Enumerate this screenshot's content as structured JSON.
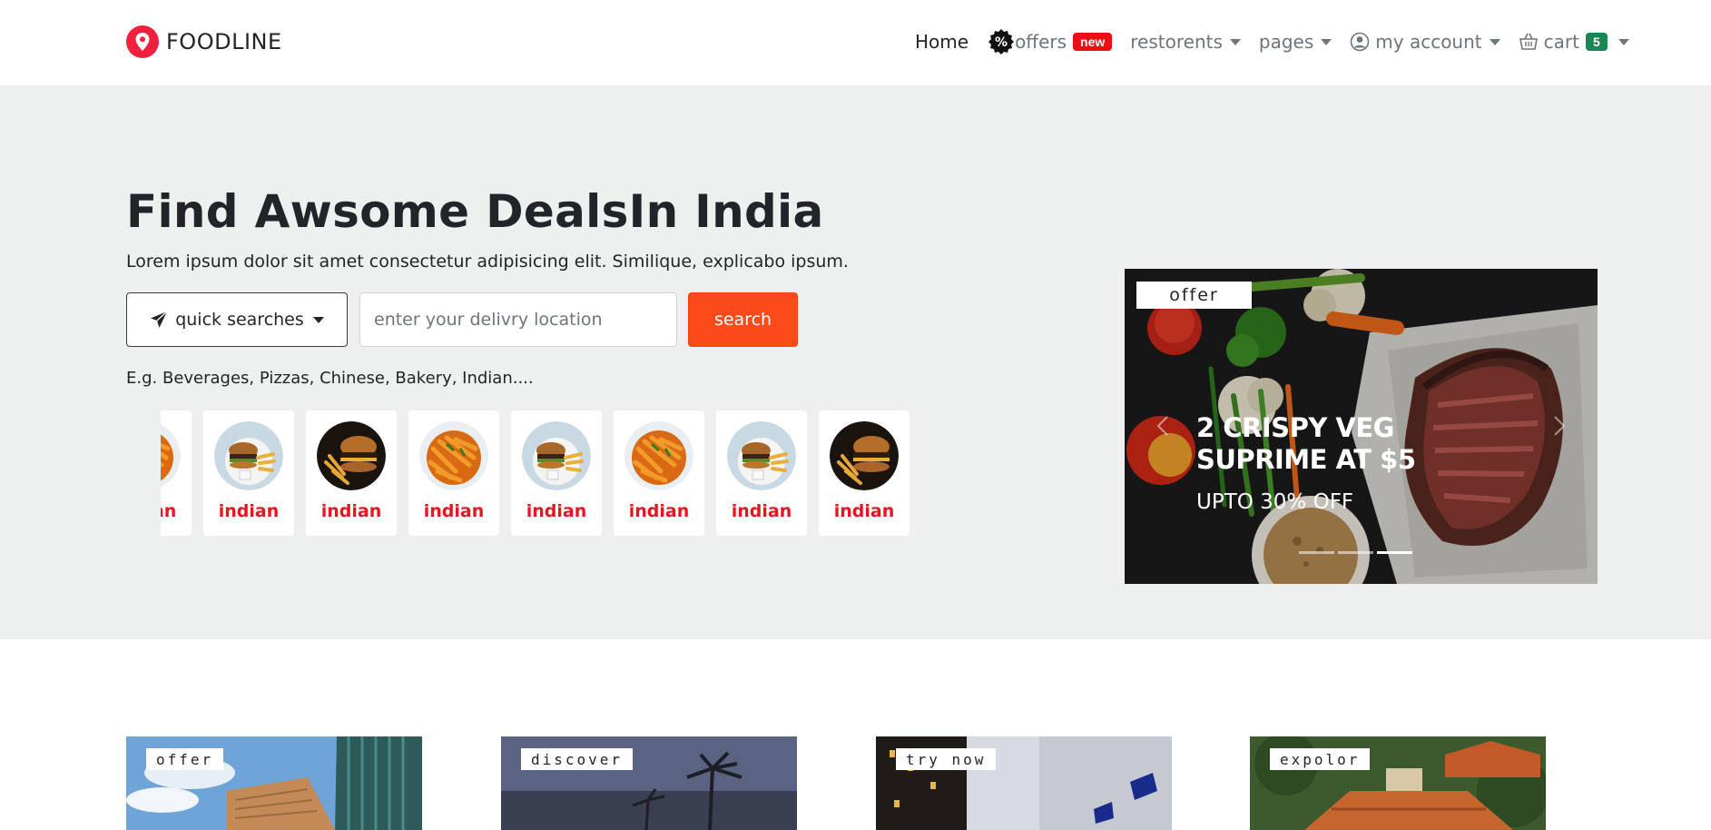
{
  "brand": {
    "name": "FOODLINE",
    "icon": "map-pin-icon",
    "color": "#f0213e"
  },
  "nav": {
    "home": "Home",
    "offers": "offers",
    "offers_badge": "new",
    "restaurants": "restorents",
    "pages": "pages",
    "account": "my account",
    "cart": "cart",
    "cart_badge": "5"
  },
  "hero": {
    "title": "Find Awsome DealsIn India",
    "subtitle": "Lorem ipsum dolor sit amet consectetur adipisicing elit. Similique, explicabo ipsum.",
    "quick_search_label": "quick searches",
    "location_placeholder": "enter your delivry location",
    "search_label": "search",
    "examples": "E.g. Beverages, Pizzas, Chinese, Bakery, Indian....",
    "accent": "#fc4a1a"
  },
  "categories": [
    {
      "label": "indian",
      "image": "pasta"
    },
    {
      "label": "indian",
      "image": "burger-plate"
    },
    {
      "label": "indian",
      "image": "burger-dark"
    },
    {
      "label": "indian",
      "image": "pasta"
    },
    {
      "label": "indian",
      "image": "burger-plate"
    },
    {
      "label": "indian",
      "image": "pasta"
    },
    {
      "label": "indian",
      "image": "burger-plate"
    },
    {
      "label": "indian",
      "image": "burger-dark"
    }
  ],
  "carousel": {
    "tag": "offer",
    "title": "2 CRISPY VEG SUPRIME AT $5",
    "subtitle": "UPTO 30% OFF",
    "slide_count": 3,
    "active_slide": 3
  },
  "cards": [
    {
      "tag": "offer"
    },
    {
      "tag": "discover"
    },
    {
      "tag": "try now"
    },
    {
      "tag": "expolor"
    }
  ]
}
